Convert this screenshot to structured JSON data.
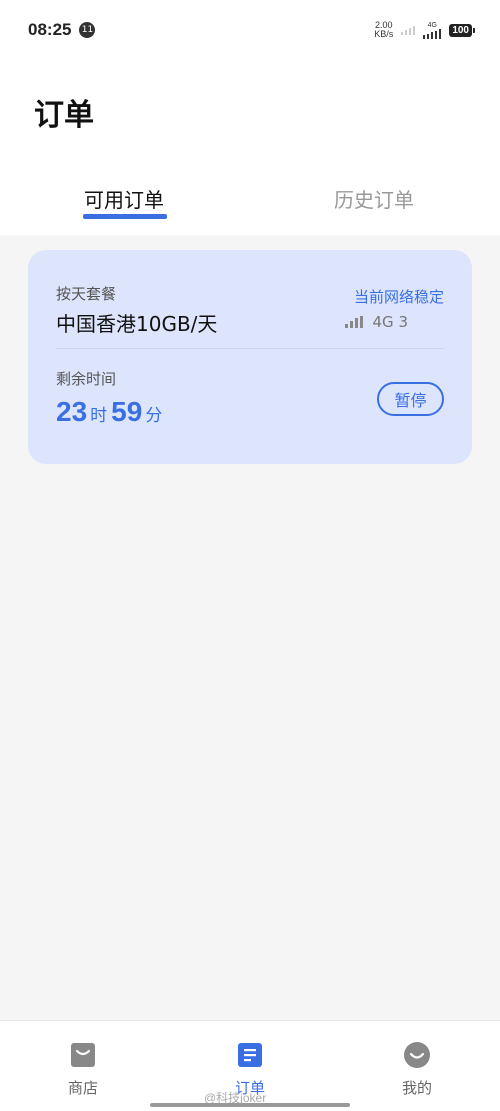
{
  "status_bar": {
    "time": "08:25",
    "notification_badge": "11",
    "net_speed_value": "2.00",
    "net_speed_unit": "KB/s",
    "network_tag": "4G",
    "battery": "100"
  },
  "header": {
    "title": "订单",
    "tabs": [
      {
        "label": "可用订单",
        "active": true
      },
      {
        "label": "历史订单",
        "active": false
      }
    ]
  },
  "order_card": {
    "plan_type": "按天套餐",
    "plan_name": "中国香港10GB/天",
    "network_status": "当前网络稳定",
    "network_signal": "4G 3",
    "remaining_label": "剩余时间",
    "remaining_hours": "23",
    "hour_unit": "时",
    "remaining_minutes": "59",
    "minute_unit": "分",
    "pause_label": "暂停"
  },
  "bottom_nav": {
    "items": [
      {
        "label": "商店",
        "icon": "shop-icon",
        "active": false
      },
      {
        "label": "订单",
        "icon": "orders-icon",
        "active": true
      },
      {
        "label": "我的",
        "icon": "profile-icon",
        "active": false
      }
    ]
  },
  "watermark": "@科技joker",
  "colors": {
    "accent": "#3a6fe4",
    "card_background": "#dde5fc",
    "page_background": "#f5f5f5"
  }
}
